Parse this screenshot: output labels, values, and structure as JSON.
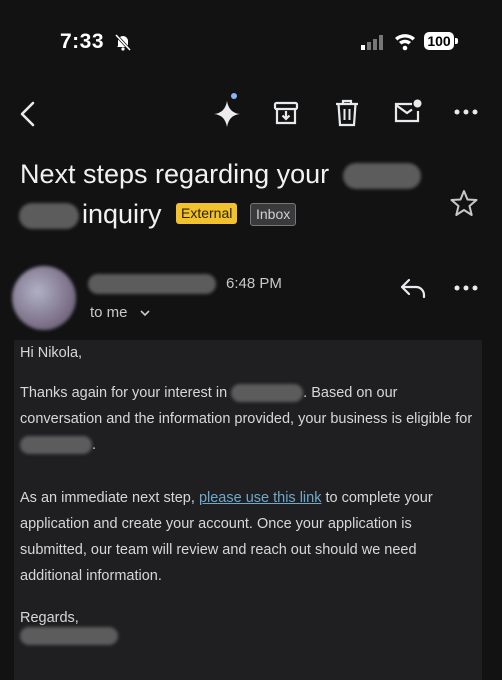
{
  "status_bar": {
    "time": "7:33",
    "battery": "100"
  },
  "toolbar": {
    "back_icon": "chevron-left-icon",
    "gemini_icon": "sparkle-icon",
    "archive_icon": "archive-icon",
    "delete_icon": "trash-icon",
    "mark_unread_icon": "mail-unread-icon",
    "more_icon": "more-horizontal-icon"
  },
  "subject": {
    "line1": "Next steps regarding your",
    "line2": "inquiry",
    "labels": [
      "External",
      "Inbox"
    ]
  },
  "message": {
    "time": "6:48 PM",
    "recipient": "to me",
    "greeting": "Hi Nikola,",
    "p1_before": "Thanks again for your interest in",
    "p1_after": ". Based on our conversation and the information provided, your business is eligible for",
    "p1_end": ".",
    "p2_before": "As an immediate next step,",
    "p2_link": "please use this link",
    "p2_after": "to complete your application and create your account. Once your application is submitted, our team will review and reach out should we need additional information.",
    "closing": "Regards,"
  },
  "colors": {
    "background": "#121212",
    "external_chip": "#f2c12e",
    "link": "#6fa8c9"
  }
}
